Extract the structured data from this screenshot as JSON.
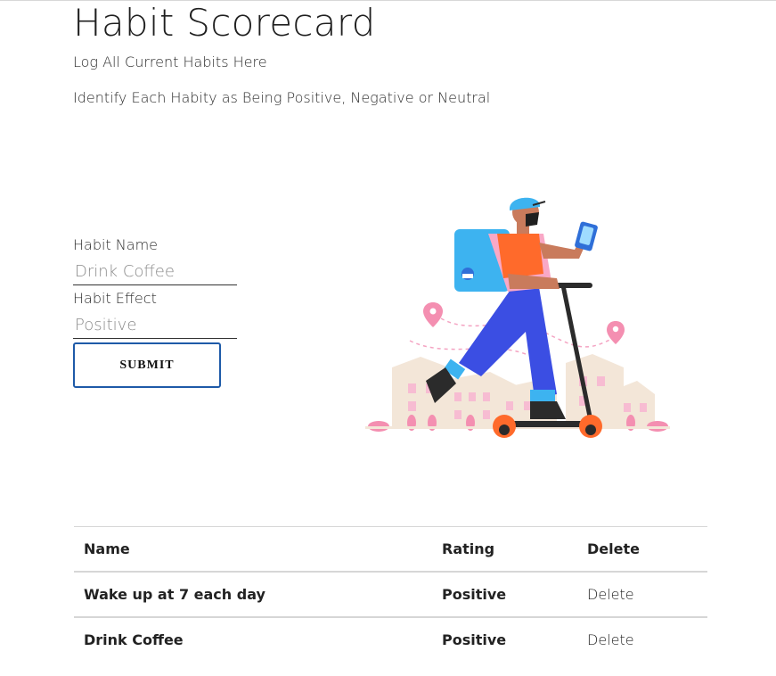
{
  "header": {
    "title": "Habit Scorecard",
    "subtitle_1": "Log All Current Habits Here",
    "subtitle_2": "Identify Each Habity as Being Positive, Negative or Neutral"
  },
  "form": {
    "habit_name_label": "Habit Name",
    "habit_name_placeholder": "Drink Coffee",
    "habit_effect_label": "Habit Effect",
    "habit_effect_placeholder": "Positive",
    "submit_label": "SUBMIT"
  },
  "illustration": {
    "icon": "scooter-courier-illustration"
  },
  "table": {
    "headers": {
      "name": "Name",
      "rating": "Rating",
      "delete": "Delete"
    },
    "rows": [
      {
        "name": "Wake up at 7 each day",
        "rating": "Positive",
        "delete": "Delete"
      },
      {
        "name": "Drink Coffee",
        "rating": "Positive",
        "delete": "Delete"
      }
    ]
  },
  "colors": {
    "button_border": "#1e5aa8",
    "rule": "#d6d6d6"
  }
}
